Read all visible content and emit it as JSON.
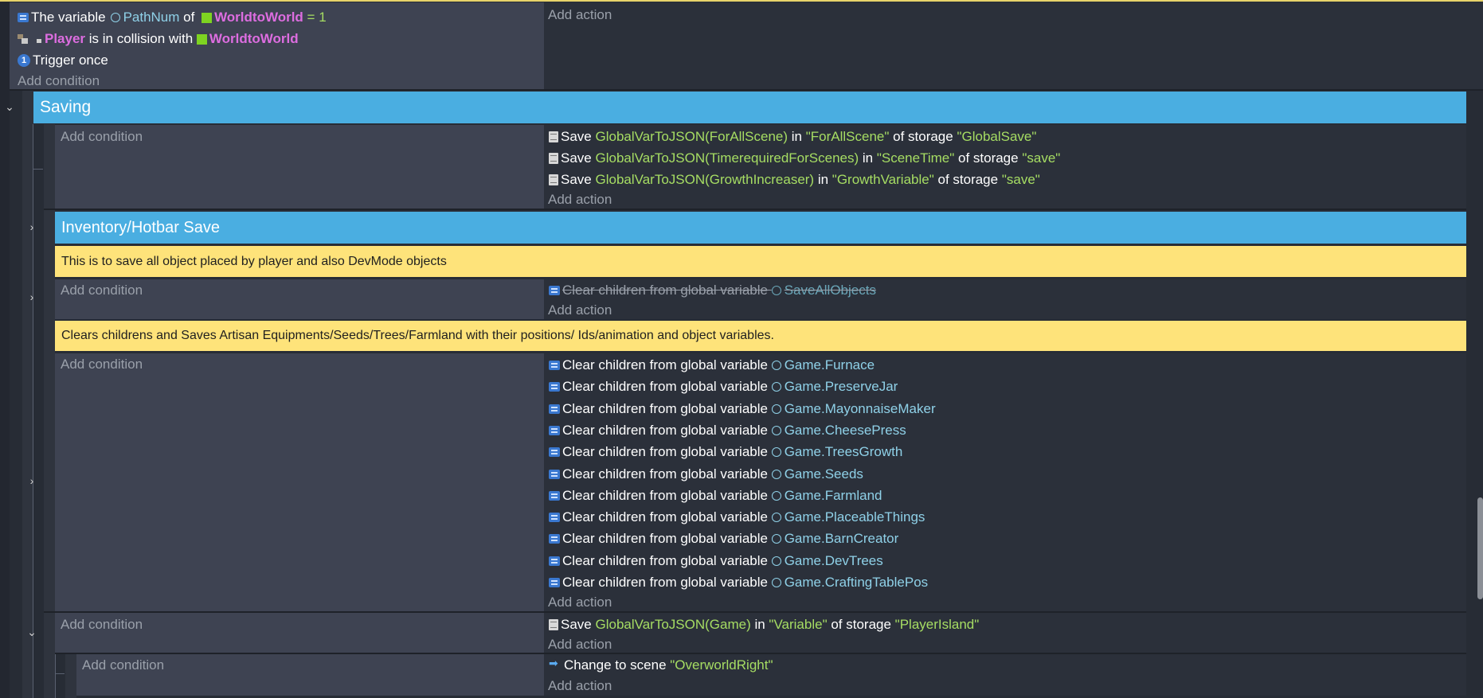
{
  "event1": {
    "conditions": [
      {
        "icon": "variable-icon",
        "text": "The variable ",
        "var": "PathNum",
        "of": " of ",
        "object": "WorldtoWorld",
        "op": " = ",
        "value": "1"
      },
      {
        "icon": "collision-icon",
        "object1": "Player",
        "mid": " is in collision with ",
        "object2": "WorldtoWorld"
      },
      {
        "icon": "trigger-once-icon",
        "badge": "1",
        "text": "Trigger once"
      }
    ],
    "add_condition": "Add condition",
    "add_action": "Add action"
  },
  "group_saving": {
    "title": "Saving"
  },
  "event2": {
    "add_condition": "Add condition",
    "actions": [
      {
        "pre": "Save ",
        "expr": "GlobalVarToJSON(ForAllScene)",
        "in": " in ",
        "key": "\"ForAllScene\"",
        "of": " of storage ",
        "storage": "\"GlobalSave\""
      },
      {
        "pre": "Save ",
        "expr": "GlobalVarToJSON(TimerequiredForScenes)",
        "in": " in ",
        "key": "\"SceneTime\"",
        "of": " of storage ",
        "storage": "\"save\""
      },
      {
        "pre": "Save ",
        "expr": "GlobalVarToJSON(GrowthIncreaser)",
        "in": " in ",
        "key": "\"GrowthVariable\"",
        "of": " of storage ",
        "storage": "\"save\""
      }
    ],
    "add_action": "Add action"
  },
  "group_inventory": {
    "title": "Inventory/Hotbar Save"
  },
  "comment1": "This is to save all object placed by player and also DevMode objects",
  "event3": {
    "add_condition": "Add condition",
    "action": {
      "text": "Clear children from global variable ",
      "var": "SaveAllObjects"
    },
    "add_action": "Add action"
  },
  "comment2": "Clears childrens and Saves Artisan  Equipments/Seeds/Trees/Farmland with their positions/ Ids/animation and object variables.",
  "event4": {
    "add_condition": "Add condition",
    "action_text": "Clear children from global variable ",
    "vars": [
      "Game.Furnace",
      "Game.PreserveJar",
      "Game.MayonnaiseMaker",
      "Game.CheesePress",
      "Game.TreesGrowth",
      "Game.Seeds",
      "Game.Farmland",
      "Game.PlaceableThings",
      "Game.BarnCreator",
      "Game.DevTrees",
      "Game.CraftingTablePos"
    ],
    "add_action": "Add action"
  },
  "event5": {
    "add_condition": "Add condition",
    "action": {
      "pre": "Save ",
      "expr": "GlobalVarToJSON(Game)",
      "in": " in ",
      "key": "\"Variable\"",
      "of": " of storage ",
      "storage": "\"PlayerIsland\""
    },
    "add_action": "Add action"
  },
  "event6": {
    "add_condition": "Add condition",
    "action": {
      "pre": "Change to scene ",
      "scene": "\"OverworldRight\""
    },
    "add_action": "Add action"
  },
  "colors": {
    "group": "#4aaee1",
    "comment": "#fee37a",
    "condition_bg": "#3e4352",
    "action_bg": "#2b303a",
    "string": "#a6dd63",
    "object": "#dd6de0",
    "variable": "#8fd1e8"
  }
}
